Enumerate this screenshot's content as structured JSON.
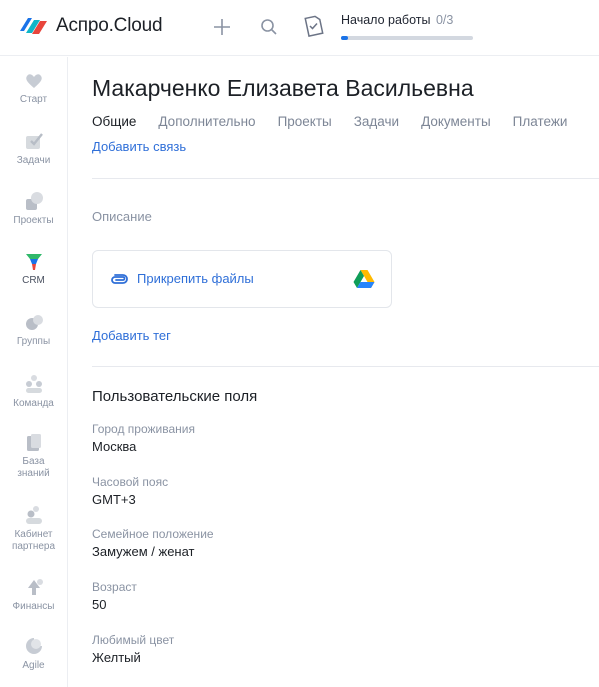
{
  "app": {
    "name": "Аспро.Cloud"
  },
  "topbar": {
    "onboarding_title": "Начало работы",
    "onboarding_count": "0/3",
    "onboarding_progress": 0.05
  },
  "sidebar": {
    "items": [
      {
        "label": "Старт",
        "icon": "heart-icon"
      },
      {
        "label": "Задачи",
        "icon": "checklist-icon"
      },
      {
        "label": "Проекты",
        "icon": "projects-icon"
      },
      {
        "label": "CRM",
        "icon": "crm-funnel-icon",
        "active": true
      },
      {
        "label": "Группы",
        "icon": "groups-icon"
      },
      {
        "label": "Команда",
        "icon": "team-icon"
      },
      {
        "label": "База\nзнаний",
        "icon": "knowledge-base-icon"
      },
      {
        "label": "Кабинет\nпартнера",
        "icon": "partner-icon"
      },
      {
        "label": "Финансы",
        "icon": "finance-icon"
      },
      {
        "label": "Agile",
        "icon": "agile-icon"
      }
    ]
  },
  "main": {
    "title": "Макарченко Елизавета Васильевна",
    "tabs": [
      "Общие",
      "Дополнительно",
      "Проекты",
      "Задачи",
      "Документы",
      "Платежи"
    ],
    "add_link_label": "Добавить связь",
    "description_label": "Описание",
    "attach_label": "Прикрепить файлы",
    "add_tag_label": "Добавить тег",
    "custom_fields_title": "Пользовательские поля",
    "fields": [
      {
        "label": "Город проживания",
        "value": "Москва"
      },
      {
        "label": "Часовой пояс",
        "value": "GMT+3"
      },
      {
        "label": "Семейное положение",
        "value": "Замужем / женат"
      },
      {
        "label": "Возраст",
        "value": "50"
      },
      {
        "label": "Любимый цвет",
        "value": "Желтый"
      }
    ]
  },
  "colors": {
    "accent": "#2f6fd8",
    "muted": "#8a93a3",
    "text": "#1c2026"
  }
}
